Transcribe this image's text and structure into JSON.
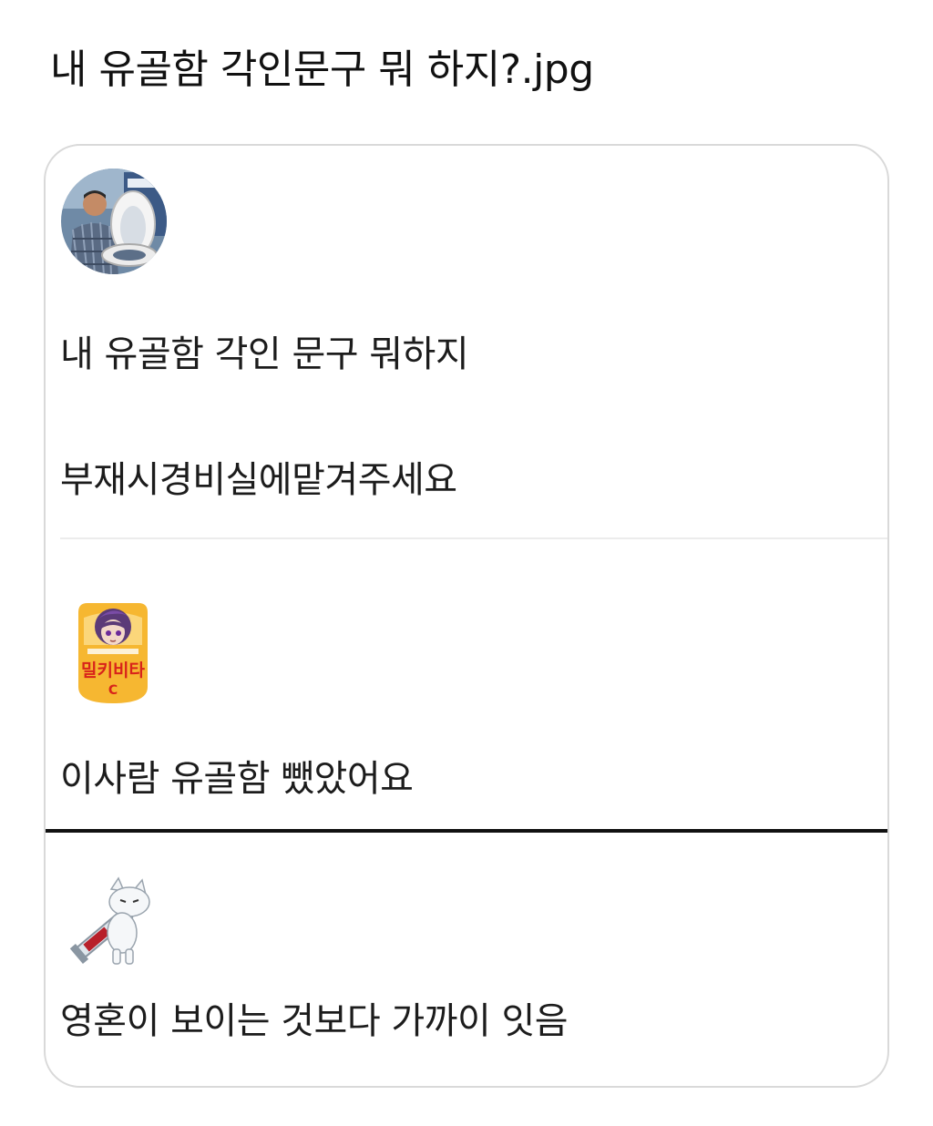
{
  "title": "내 유골함 각인문구 뭐 하지?.jpg",
  "posts": [
    {
      "avatar": "man-holding-toilet-seat-avatar",
      "lines": [
        "내 유골함 각인 문구 뭐하지",
        "부재시경비실에맡겨주세요"
      ]
    },
    {
      "avatar": "milkyvita-anime-badge-avatar",
      "avatar_text": "밀키비타",
      "avatar_subtext": "C",
      "lines": [
        "이사람 유골함 뺐았어요"
      ]
    },
    {
      "avatar": "white-cat-with-syringe-avatar",
      "lines": [
        "영혼이 보이는 것보다 가까이 잇음"
      ]
    }
  ],
  "colors": {
    "card_border": "#d9d9d9",
    "light_divider": "#ececec",
    "dark_divider": "#111111",
    "badge_yellow": "#f6b731",
    "badge_red": "#d8231a"
  }
}
